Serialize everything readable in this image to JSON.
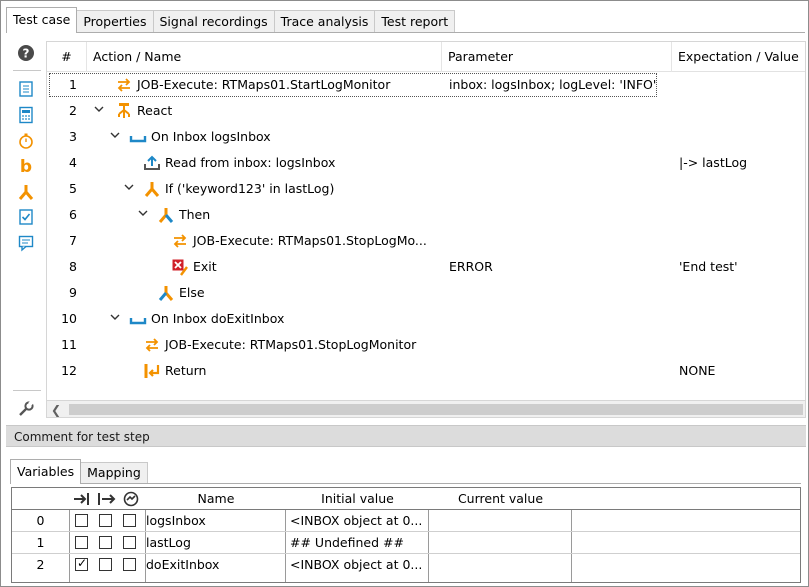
{
  "tabs": [
    {
      "label": "Test case",
      "active": true
    },
    {
      "label": "Properties",
      "active": false
    },
    {
      "label": "Signal recordings",
      "active": false
    },
    {
      "label": "Trace analysis",
      "active": false
    },
    {
      "label": "Test report",
      "active": false
    }
  ],
  "grid": {
    "columns": [
      "#",
      "Action / Name",
      "Parameter",
      "Expectation / Value"
    ],
    "rows": [
      {
        "num": "1",
        "name": "JOB-Execute: RTMaps01.StartLogMonitor",
        "param": "inbox: logsInbox; logLevel: 'INFO'",
        "expect": "",
        "icon": "job-execute-icon"
      },
      {
        "num": "2",
        "name": "React",
        "param": "",
        "expect": "",
        "icon": "react-icon"
      },
      {
        "num": "3",
        "name": "On Inbox logsInbox",
        "param": "",
        "expect": "",
        "icon": "inbox-icon"
      },
      {
        "num": "4",
        "name": "Read from inbox: logsInbox",
        "param": "",
        "expect": "|-> lastLog",
        "icon": "read-inbox-icon"
      },
      {
        "num": "5",
        "name": "If ('keyword123' in lastLog)",
        "param": "",
        "expect": "",
        "icon": "if-branch-icon"
      },
      {
        "num": "6",
        "name": "Then",
        "param": "",
        "expect": "",
        "icon": "then-branch-icon"
      },
      {
        "num": "7",
        "name": "JOB-Execute: RTMaps01.StopLogMo...",
        "param": "",
        "expect": "",
        "icon": "job-execute-icon"
      },
      {
        "num": "8",
        "name": "Exit",
        "param": "ERROR",
        "expect": "'End test'",
        "icon": "exit-icon"
      },
      {
        "num": "9",
        "name": "Else",
        "param": "",
        "expect": "",
        "icon": "else-branch-icon"
      },
      {
        "num": "10",
        "name": "On Inbox doExitInbox",
        "param": "",
        "expect": "",
        "icon": "inbox-icon"
      },
      {
        "num": "11",
        "name": "JOB-Execute: RTMaps01.StopLogMonitor",
        "param": "",
        "expect": "",
        "icon": "job-execute-icon"
      },
      {
        "num": "12",
        "name": "Return",
        "param": "",
        "expect": "NONE",
        "icon": "return-icon"
      }
    ]
  },
  "comment_label": "Comment for test step",
  "bottom_tabs": [
    {
      "label": "Variables",
      "active": true
    },
    {
      "label": "Mapping",
      "active": false
    }
  ],
  "variables": {
    "columns": [
      "Name",
      "Initial value",
      "Current value"
    ],
    "rows": [
      {
        "num": "0",
        "name": "logsInbox",
        "initial": "<INBOX object at 0...",
        "current": "",
        "checks": [
          false,
          false,
          false
        ]
      },
      {
        "num": "1",
        "name": "lastLog",
        "initial": "## Undefined ##",
        "current": "",
        "checks": [
          false,
          false,
          false
        ]
      },
      {
        "num": "2",
        "name": "doExitInbox",
        "initial": "<INBOX object at 0...",
        "current": "",
        "checks": [
          true,
          false,
          false
        ]
      }
    ]
  },
  "checkmark": "✓",
  "colors": {
    "accent_orange": "#f39200",
    "accent_blue": "#1e88c7",
    "exit_red": "#d0202a"
  }
}
